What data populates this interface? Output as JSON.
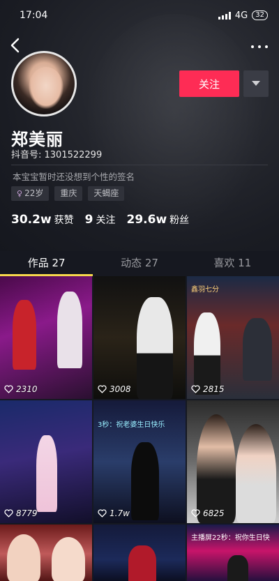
{
  "status_bar": {
    "time": "17:04",
    "network": "4G",
    "battery": "32"
  },
  "profile": {
    "name": "郑美丽",
    "douyin_id": "抖音号: 1301522299",
    "bio": "本宝宝暂时还没想到个性的签名",
    "follow_label": "关注",
    "tags": [
      {
        "label": "22岁",
        "icon": "female-icon"
      },
      {
        "label": "重庆"
      },
      {
        "label": "天蝎座"
      }
    ],
    "stats": [
      {
        "value": "30.2w",
        "label": "获赞"
      },
      {
        "value": "9",
        "label": "关注"
      },
      {
        "value": "29.6w",
        "label": "粉丝"
      }
    ]
  },
  "tabs": [
    {
      "label": "作品 27",
      "active": true
    },
    {
      "label": "动态 27",
      "active": false
    },
    {
      "label": "喜欢 11",
      "active": false
    }
  ],
  "videos": [
    {
      "likes": "2310"
    },
    {
      "likes": "3008"
    },
    {
      "likes": "2815"
    },
    {
      "likes": "8779"
    },
    {
      "likes": "1.7w"
    },
    {
      "likes": "6825"
    },
    {
      "likes": ""
    },
    {
      "likes": ""
    },
    {
      "likes": ""
    }
  ],
  "video_banners": {
    "b2": "3秒：祝老婆生日快乐",
    "b3": "鑫羽七分",
    "b9": "主播屏22秒：祝你生日快"
  },
  "colors": {
    "accent": "#fe2c55",
    "tab_indicator": "#f7d84c",
    "background": "#151821"
  }
}
